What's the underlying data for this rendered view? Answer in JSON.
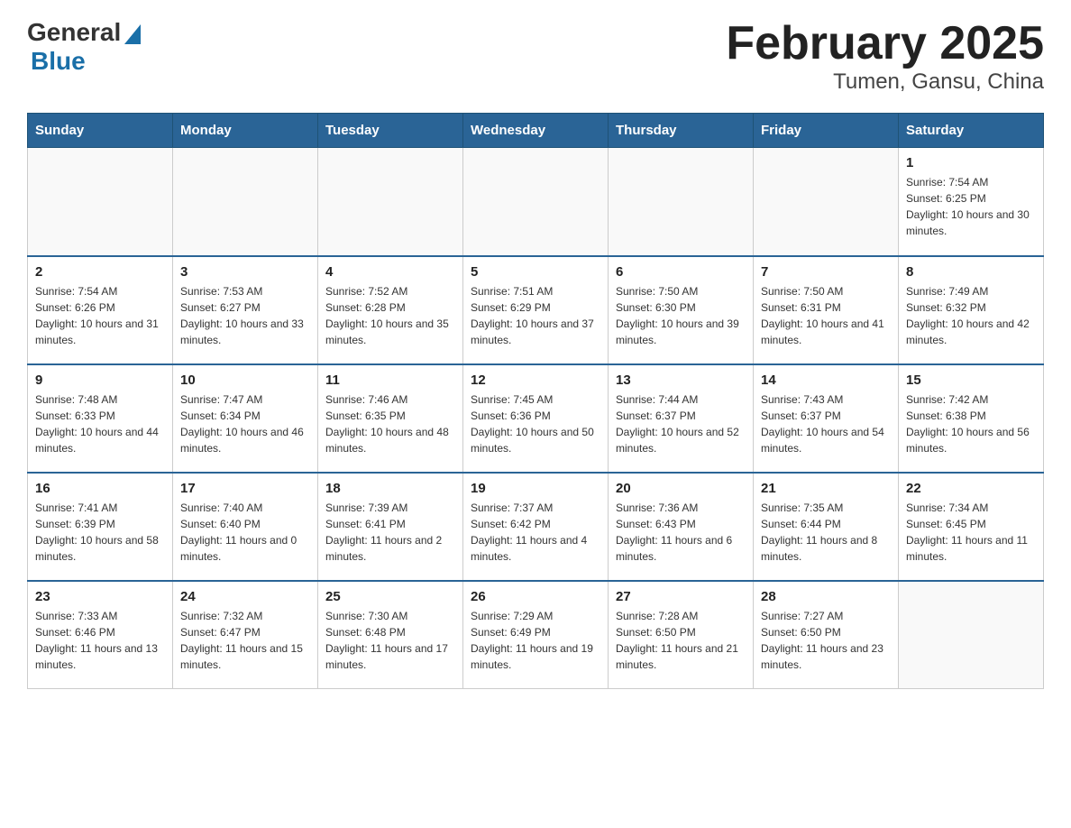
{
  "header": {
    "logo_general": "General",
    "logo_blue": "Blue",
    "title": "February 2025",
    "subtitle": "Tumen, Gansu, China"
  },
  "days_of_week": [
    "Sunday",
    "Monday",
    "Tuesday",
    "Wednesday",
    "Thursday",
    "Friday",
    "Saturday"
  ],
  "weeks": [
    [
      {
        "day": "",
        "info": ""
      },
      {
        "day": "",
        "info": ""
      },
      {
        "day": "",
        "info": ""
      },
      {
        "day": "",
        "info": ""
      },
      {
        "day": "",
        "info": ""
      },
      {
        "day": "",
        "info": ""
      },
      {
        "day": "1",
        "info": "Sunrise: 7:54 AM\nSunset: 6:25 PM\nDaylight: 10 hours and 30 minutes."
      }
    ],
    [
      {
        "day": "2",
        "info": "Sunrise: 7:54 AM\nSunset: 6:26 PM\nDaylight: 10 hours and 31 minutes."
      },
      {
        "day": "3",
        "info": "Sunrise: 7:53 AM\nSunset: 6:27 PM\nDaylight: 10 hours and 33 minutes."
      },
      {
        "day": "4",
        "info": "Sunrise: 7:52 AM\nSunset: 6:28 PM\nDaylight: 10 hours and 35 minutes."
      },
      {
        "day": "5",
        "info": "Sunrise: 7:51 AM\nSunset: 6:29 PM\nDaylight: 10 hours and 37 minutes."
      },
      {
        "day": "6",
        "info": "Sunrise: 7:50 AM\nSunset: 6:30 PM\nDaylight: 10 hours and 39 minutes."
      },
      {
        "day": "7",
        "info": "Sunrise: 7:50 AM\nSunset: 6:31 PM\nDaylight: 10 hours and 41 minutes."
      },
      {
        "day": "8",
        "info": "Sunrise: 7:49 AM\nSunset: 6:32 PM\nDaylight: 10 hours and 42 minutes."
      }
    ],
    [
      {
        "day": "9",
        "info": "Sunrise: 7:48 AM\nSunset: 6:33 PM\nDaylight: 10 hours and 44 minutes."
      },
      {
        "day": "10",
        "info": "Sunrise: 7:47 AM\nSunset: 6:34 PM\nDaylight: 10 hours and 46 minutes."
      },
      {
        "day": "11",
        "info": "Sunrise: 7:46 AM\nSunset: 6:35 PM\nDaylight: 10 hours and 48 minutes."
      },
      {
        "day": "12",
        "info": "Sunrise: 7:45 AM\nSunset: 6:36 PM\nDaylight: 10 hours and 50 minutes."
      },
      {
        "day": "13",
        "info": "Sunrise: 7:44 AM\nSunset: 6:37 PM\nDaylight: 10 hours and 52 minutes."
      },
      {
        "day": "14",
        "info": "Sunrise: 7:43 AM\nSunset: 6:37 PM\nDaylight: 10 hours and 54 minutes."
      },
      {
        "day": "15",
        "info": "Sunrise: 7:42 AM\nSunset: 6:38 PM\nDaylight: 10 hours and 56 minutes."
      }
    ],
    [
      {
        "day": "16",
        "info": "Sunrise: 7:41 AM\nSunset: 6:39 PM\nDaylight: 10 hours and 58 minutes."
      },
      {
        "day": "17",
        "info": "Sunrise: 7:40 AM\nSunset: 6:40 PM\nDaylight: 11 hours and 0 minutes."
      },
      {
        "day": "18",
        "info": "Sunrise: 7:39 AM\nSunset: 6:41 PM\nDaylight: 11 hours and 2 minutes."
      },
      {
        "day": "19",
        "info": "Sunrise: 7:37 AM\nSunset: 6:42 PM\nDaylight: 11 hours and 4 minutes."
      },
      {
        "day": "20",
        "info": "Sunrise: 7:36 AM\nSunset: 6:43 PM\nDaylight: 11 hours and 6 minutes."
      },
      {
        "day": "21",
        "info": "Sunrise: 7:35 AM\nSunset: 6:44 PM\nDaylight: 11 hours and 8 minutes."
      },
      {
        "day": "22",
        "info": "Sunrise: 7:34 AM\nSunset: 6:45 PM\nDaylight: 11 hours and 11 minutes."
      }
    ],
    [
      {
        "day": "23",
        "info": "Sunrise: 7:33 AM\nSunset: 6:46 PM\nDaylight: 11 hours and 13 minutes."
      },
      {
        "day": "24",
        "info": "Sunrise: 7:32 AM\nSunset: 6:47 PM\nDaylight: 11 hours and 15 minutes."
      },
      {
        "day": "25",
        "info": "Sunrise: 7:30 AM\nSunset: 6:48 PM\nDaylight: 11 hours and 17 minutes."
      },
      {
        "day": "26",
        "info": "Sunrise: 7:29 AM\nSunset: 6:49 PM\nDaylight: 11 hours and 19 minutes."
      },
      {
        "day": "27",
        "info": "Sunrise: 7:28 AM\nSunset: 6:50 PM\nDaylight: 11 hours and 21 minutes."
      },
      {
        "day": "28",
        "info": "Sunrise: 7:27 AM\nSunset: 6:50 PM\nDaylight: 11 hours and 23 minutes."
      },
      {
        "day": "",
        "info": ""
      }
    ]
  ]
}
